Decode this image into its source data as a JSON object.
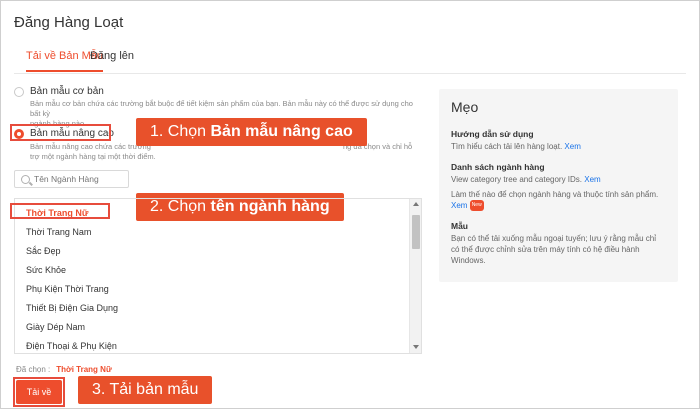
{
  "page": {
    "title": "Đăng Hàng Loạt"
  },
  "tabs": [
    {
      "label": "Tải về Bản Mẫu"
    },
    {
      "label": "Đăng lên"
    }
  ],
  "templates": {
    "basic": {
      "label": "Bản mẫu cơ bản",
      "desc_line1": "Bản mẫu cơ bản chứa các trường bắt buộc để tiết kiệm sản phẩm của bạn. Bản mẫu này có thể được sử dụng cho bất kỳ",
      "desc_line2": "ngành hàng nào"
    },
    "advanced": {
      "label": "Bản mẫu nâng cao",
      "desc_line1": "Bản mẫu nâng cao chứa các trường",
      "desc_line1_tail": "ng đã chọn và chỉ hỗ",
      "desc_line2": "trợ một ngành hàng tại một thời điểm."
    }
  },
  "search": {
    "placeholder": "Tên Ngành Hàng"
  },
  "categories": [
    "Thời Trang Nữ",
    "Thời Trang Nam",
    "Sắc Đẹp",
    "Sức Khỏe",
    "Phụ Kiện Thời Trang",
    "Thiết Bị Điện Gia Dụng",
    "Giày Dép Nam",
    "Điện Thoại & Phụ Kiện"
  ],
  "selection": {
    "label": "Đã chọn :",
    "value": "Thời Trang Nữ"
  },
  "download_button": {
    "label": "Tải về"
  },
  "callouts": {
    "c1_prefix": "1. Chọn ",
    "c1_bold": "Bản mẫu nâng cao",
    "c2_prefix": "2. Chọn ",
    "c2_bold": "tên ngành hàng",
    "c3": "3. Tải bản mẫu"
  },
  "tips": {
    "title": "Mẹo",
    "sections": [
      {
        "heading": "Hướng dẫn sử dụng",
        "text": "Tìm hiểu cách tải lên hàng loạt.",
        "link": "Xem"
      },
      {
        "heading": "Danh sách ngành hàng",
        "text": "View category tree and category IDs.",
        "link": "Xem"
      },
      {
        "heading": "",
        "text": "Làm thế nào để chọn ngành hàng và thuộc tính sản phẩm.",
        "link": "Xem",
        "badge": "New"
      },
      {
        "heading": "Mẫu",
        "text": "Bạn có thể tải xuống mẫu ngoại tuyến; lưu ý rằng mẫu chỉ có thể được chỉnh sửa trên máy tính có hệ điều hành Windows.",
        "link": ""
      }
    ]
  },
  "colors": {
    "accent": "#ee4d2d",
    "callout": "#e8512b",
    "link": "#1a73e8",
    "highlight_border": "#e74c3c"
  }
}
